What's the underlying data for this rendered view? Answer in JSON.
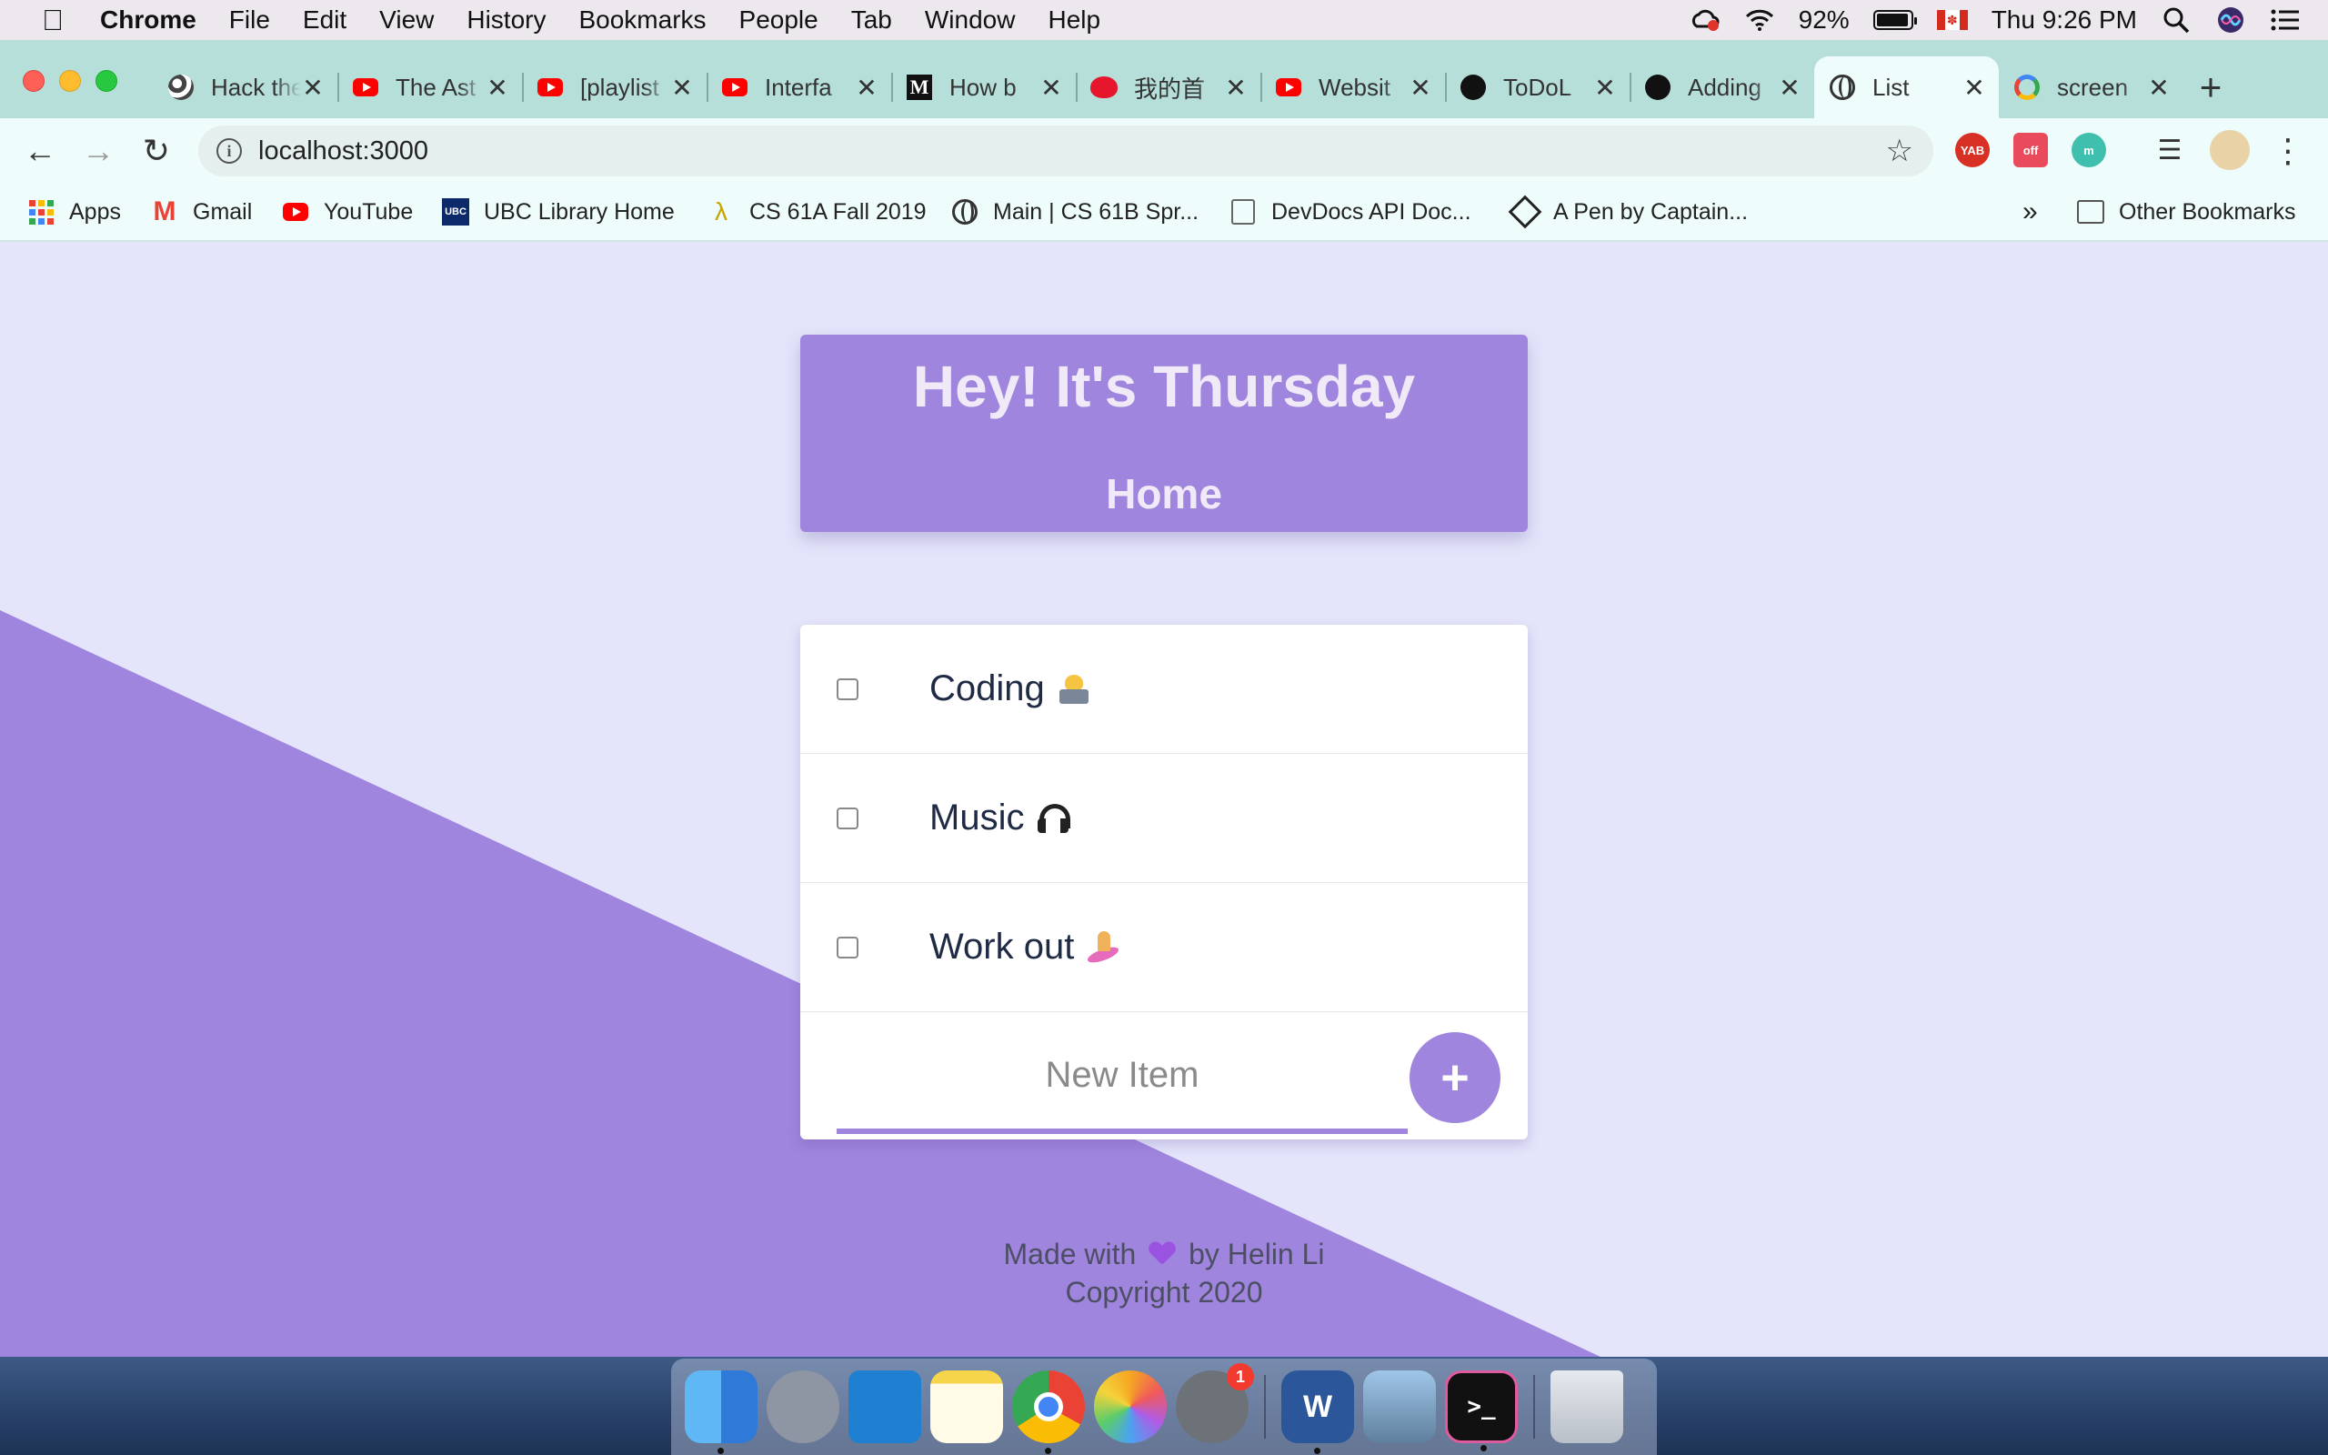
{
  "menubar": {
    "app_name": "Chrome",
    "menus": [
      "File",
      "Edit",
      "View",
      "History",
      "Bookmarks",
      "People",
      "Tab",
      "Window",
      "Help"
    ],
    "battery_percent": "92%",
    "clock": "Thu 9:26 PM",
    "icons": [
      "creative-cloud-icon",
      "wifi-icon",
      "battery-icon",
      "canada-flag-icon",
      "spotlight-search-icon",
      "siri-icon",
      "notification-center-icon"
    ]
  },
  "tabs": [
    {
      "title": "Hack the",
      "icon": "hack-globe-icon"
    },
    {
      "title": "The Ast",
      "icon": "youtube-icon"
    },
    {
      "title": "[playlist",
      "icon": "youtube-icon"
    },
    {
      "title": "Interfa",
      "icon": "youtube-icon"
    },
    {
      "title": "How b",
      "icon": "medium-icon"
    },
    {
      "title": "我的首",
      "icon": "weibo-icon"
    },
    {
      "title": "Websit",
      "icon": "youtube-icon"
    },
    {
      "title": "ToDoL",
      "icon": "github-icon"
    },
    {
      "title": "Adding",
      "icon": "github-icon"
    },
    {
      "title": "List",
      "icon": "globe-icon",
      "active": true
    },
    {
      "title": "screen",
      "icon": "google-icon"
    }
  ],
  "toolbar": {
    "url": "localhost:3000",
    "extensions": [
      {
        "label": "YAB",
        "color": "#d93025"
      },
      {
        "label": "off",
        "color": "#e94a5c"
      },
      {
        "label": "m",
        "color": "#3fbfad"
      }
    ]
  },
  "bookmarks": [
    {
      "label": "Apps",
      "icon": "apps-grid-icon"
    },
    {
      "label": "Gmail",
      "icon": "gmail-icon"
    },
    {
      "label": "YouTube",
      "icon": "youtube-icon"
    },
    {
      "label": "UBC Library Home",
      "icon": "ubc-icon"
    },
    {
      "label": "CS 61A Fall 2019",
      "icon": "lambda-icon"
    },
    {
      "label": "Main | CS 61B Spr...",
      "icon": "globe-icon"
    },
    {
      "label": "DevDocs API Doc...",
      "icon": "devdocs-icon"
    },
    {
      "label": "A Pen by Captain...",
      "icon": "codepen-icon"
    }
  ],
  "bookmarks_overflow": "»",
  "other_bookmarks": "Other Bookmarks",
  "app": {
    "heading": "Hey! It's Thursday",
    "list_name": "Home",
    "items": [
      {
        "label": "Coding",
        "emoji": "technologist-emoji",
        "checked": false
      },
      {
        "label": "Music",
        "emoji": "headphones-emoji",
        "checked": false
      },
      {
        "label": "Work out",
        "emoji": "surfer-emoji",
        "checked": false
      }
    ],
    "new_item_placeholder": "New Item",
    "add_button_label": "+",
    "footer_line1_before": "Made with",
    "footer_line1_after": "by Helin Li",
    "footer_line2": "Copyright 2020",
    "colors": {
      "accent": "#a085de",
      "background": "#e4e5fb"
    }
  },
  "dock": {
    "apps": [
      "finder-icon",
      "launchpad-icon",
      "vscode-icon",
      "notes-icon",
      "chrome-icon",
      "photos-icon",
      "system-preferences-icon",
      "word-icon",
      "preview-icon",
      "terminal-icon",
      "trash-icon"
    ],
    "system_preferences_badge": "1",
    "word_label": "W"
  }
}
